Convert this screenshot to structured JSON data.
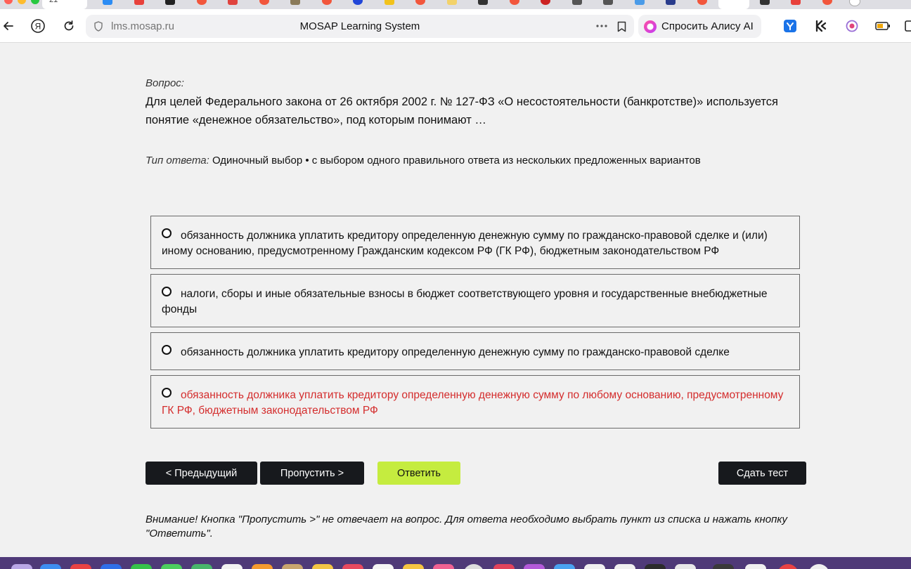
{
  "browser": {
    "url_host": "lms.mosap.ru",
    "page_title": "MOSAP Learning System",
    "alice_label": "Спросить Алису AI",
    "tab_number": "21"
  },
  "question": {
    "label": "Вопрос:",
    "text": "Для целей Федерального закона от 26 октября 2002 г. № 127-ФЗ «О несостоятельности (банкротстве)» используется понятие «денежное обязательство», под которым понимают …",
    "type_label": "Тип ответа:",
    "type_value": "Одиночный выбор • с выбором одного правильного ответа из нескольких предложенных вариантов"
  },
  "options": [
    {
      "text": "обязанность должника уплатить кредитору определенную денежную сумму по гражданско-правовой сделке и (или) иному основанию, предусмотренному Гражданским кодексом РФ (ГК РФ), бюджетным законодательством РФ",
      "highlighted": false
    },
    {
      "text": "налоги, сборы и иные обязательные взносы в бюджет соответствующего уровня и государственные внебюджетные фонды",
      "highlighted": false
    },
    {
      "text": "обязанность должника уплатить кредитору определенную денежную сумму по гражданско-правовой сделке",
      "highlighted": false
    },
    {
      "text": "обязанность должника уплатить кредитору определенную денежную сумму по любому основанию, предусмотренному ГК РФ, бюджетным законодательством РФ",
      "highlighted": true
    }
  ],
  "buttons": {
    "prev": "< Предыдущий",
    "skip": "Пропустить >",
    "answer": "Ответить",
    "submit": "Сдать тест"
  },
  "notice": "Внимание! Кнопка \"Пропустить >\" не отвечает на вопрос. Для ответа необходимо выбрать пункт из списка и нажать кнопку \"Ответить\".",
  "colors": {
    "answer_button": "#c5ec3f",
    "dark_button": "#17191d",
    "highlight_text": "#d42d2d",
    "page_background": "#f1f1f1"
  }
}
